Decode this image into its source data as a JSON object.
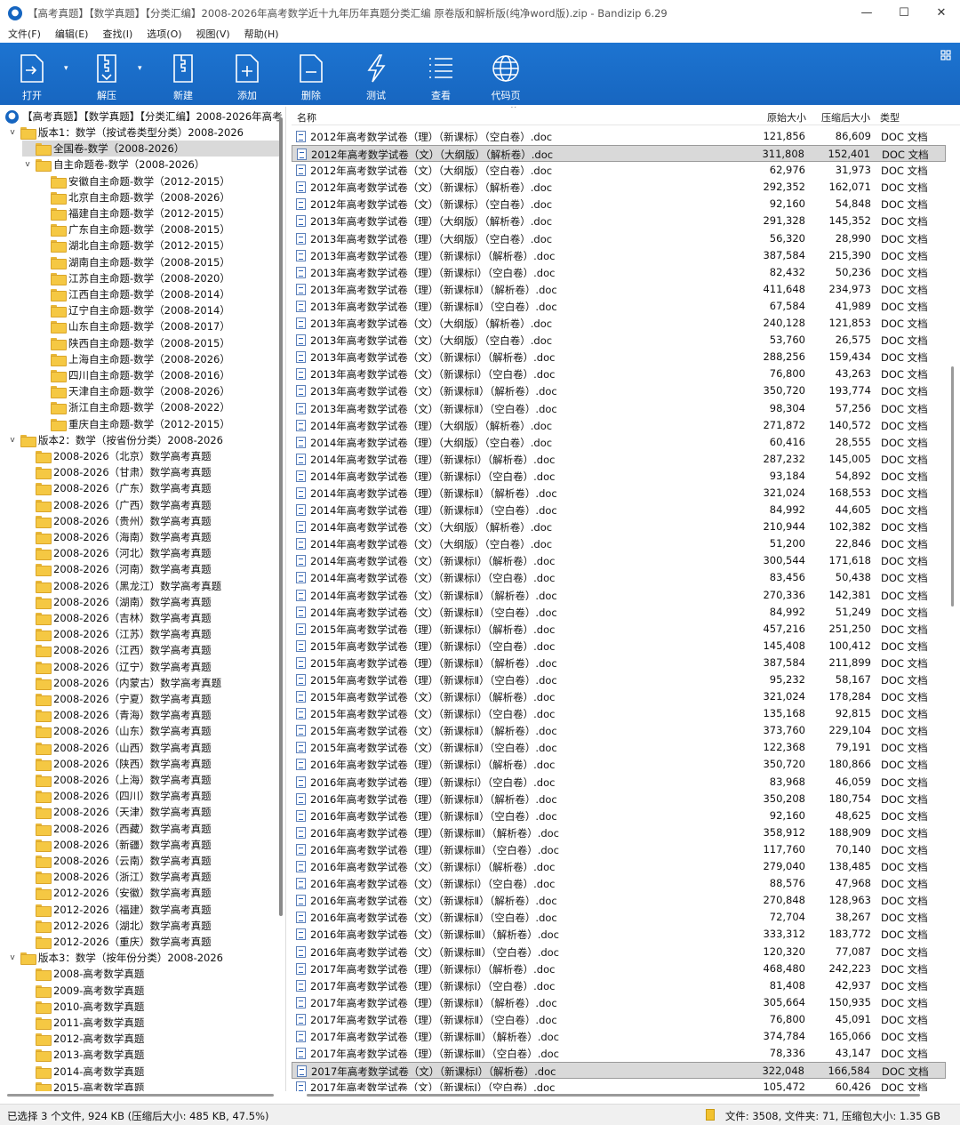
{
  "window": {
    "title": "【高考真题】【数学真题】【分类汇编】2008-2026年高考数学近十九年历年真题分类汇编  原卷版和解析版(纯净word版).zip - Bandizip 6.29",
    "controls": [
      "—",
      "☐",
      "✕"
    ]
  },
  "menu": [
    "文件(F)",
    "编辑(E)",
    "查找(I)",
    "选项(O)",
    "视图(V)",
    "帮助(H)"
  ],
  "toolbar": {
    "open": "打开",
    "extract": "解压",
    "new": "新建",
    "add": "添加",
    "delete": "删除",
    "test": "测试",
    "view": "查看",
    "codepage": "代码页"
  },
  "tree": {
    "root": "【高考真题】【数学真题】【分类汇编】2008-2026年高考",
    "nodes": [
      {
        "label": "版本1：数学（按试卷类型分类）2008-2026",
        "level": 1,
        "expand": "v"
      },
      {
        "label": "全国卷-数学（2008-2026）",
        "level": 2,
        "expand": "",
        "selected": true
      },
      {
        "label": "自主命题卷-数学（2008-2026）",
        "level": 2,
        "expand": "v"
      },
      {
        "label": "安徽自主命题-数学（2012-2015）",
        "level": 3,
        "expand": ""
      },
      {
        "label": "北京自主命题-数学（2008-2026）",
        "level": 3,
        "expand": ""
      },
      {
        "label": "福建自主命题-数学（2012-2015）",
        "level": 3,
        "expand": ""
      },
      {
        "label": "广东自主命题-数学（2008-2015）",
        "level": 3,
        "expand": ""
      },
      {
        "label": "湖北自主命题-数学（2012-2015）",
        "level": 3,
        "expand": ""
      },
      {
        "label": "湖南自主命题-数学（2008-2015）",
        "level": 3,
        "expand": ""
      },
      {
        "label": "江苏自主命题-数学（2008-2020）",
        "level": 3,
        "expand": ""
      },
      {
        "label": "江西自主命题-数学（2008-2014）",
        "level": 3,
        "expand": ""
      },
      {
        "label": "辽宁自主命题-数学（2008-2014）",
        "level": 3,
        "expand": ""
      },
      {
        "label": "山东自主命题-数学（2008-2017）",
        "level": 3,
        "expand": ""
      },
      {
        "label": "陕西自主命题-数学（2008-2015）",
        "level": 3,
        "expand": ""
      },
      {
        "label": "上海自主命题-数学（2008-2026）",
        "level": 3,
        "expand": ""
      },
      {
        "label": "四川自主命题-数学（2008-2016）",
        "level": 3,
        "expand": ""
      },
      {
        "label": "天津自主命题-数学（2008-2026）",
        "level": 3,
        "expand": ""
      },
      {
        "label": "浙江自主命题-数学（2008-2022）",
        "level": 3,
        "expand": ""
      },
      {
        "label": "重庆自主命题-数学（2012-2015）",
        "level": 3,
        "expand": ""
      },
      {
        "label": "版本2：数学（按省份分类）2008-2026",
        "level": 1,
        "expand": "v"
      },
      {
        "label": "2008-2026（北京）数学高考真题",
        "level": 2,
        "expand": ""
      },
      {
        "label": "2008-2026（甘肃）数学高考真题",
        "level": 2,
        "expand": ""
      },
      {
        "label": "2008-2026（广东）数学高考真题",
        "level": 2,
        "expand": ""
      },
      {
        "label": "2008-2026（广西）数学高考真题",
        "level": 2,
        "expand": ""
      },
      {
        "label": "2008-2026（贵州）数学高考真题",
        "level": 2,
        "expand": ""
      },
      {
        "label": "2008-2026（海南）数学高考真题",
        "level": 2,
        "expand": ""
      },
      {
        "label": "2008-2026（河北）数学高考真题",
        "level": 2,
        "expand": ""
      },
      {
        "label": "2008-2026（河南）数学高考真题",
        "level": 2,
        "expand": ""
      },
      {
        "label": "2008-2026（黑龙江）数学高考真题",
        "level": 2,
        "expand": ""
      },
      {
        "label": "2008-2026（湖南）数学高考真题",
        "level": 2,
        "expand": ""
      },
      {
        "label": "2008-2026（吉林）数学高考真题",
        "level": 2,
        "expand": ""
      },
      {
        "label": "2008-2026（江苏）数学高考真题",
        "level": 2,
        "expand": ""
      },
      {
        "label": "2008-2026（江西）数学高考真题",
        "level": 2,
        "expand": ""
      },
      {
        "label": "2008-2026（辽宁）数学高考真题",
        "level": 2,
        "expand": ""
      },
      {
        "label": "2008-2026（内蒙古）数学高考真题",
        "level": 2,
        "expand": ""
      },
      {
        "label": "2008-2026（宁夏）数学高考真题",
        "level": 2,
        "expand": ""
      },
      {
        "label": "2008-2026（青海）数学高考真题",
        "level": 2,
        "expand": ""
      },
      {
        "label": "2008-2026（山东）数学高考真题",
        "level": 2,
        "expand": ""
      },
      {
        "label": "2008-2026（山西）数学高考真题",
        "level": 2,
        "expand": ""
      },
      {
        "label": "2008-2026（陕西）数学高考真题",
        "level": 2,
        "expand": ""
      },
      {
        "label": "2008-2026（上海）数学高考真题",
        "level": 2,
        "expand": ""
      },
      {
        "label": "2008-2026（四川）数学高考真题",
        "level": 2,
        "expand": ""
      },
      {
        "label": "2008-2026（天津）数学高考真题",
        "level": 2,
        "expand": ""
      },
      {
        "label": "2008-2026（西藏）数学高考真题",
        "level": 2,
        "expand": ""
      },
      {
        "label": "2008-2026（新疆）数学高考真题",
        "level": 2,
        "expand": ""
      },
      {
        "label": "2008-2026（云南）数学高考真题",
        "level": 2,
        "expand": ""
      },
      {
        "label": "2008-2026（浙江）数学高考真题",
        "level": 2,
        "expand": ""
      },
      {
        "label": "2012-2026（安徽）数学高考真题",
        "level": 2,
        "expand": ""
      },
      {
        "label": "2012-2026（福建）数学高考真题",
        "level": 2,
        "expand": ""
      },
      {
        "label": "2012-2026（湖北）数学高考真题",
        "level": 2,
        "expand": ""
      },
      {
        "label": "2012-2026（重庆）数学高考真题",
        "level": 2,
        "expand": ""
      },
      {
        "label": "版本3：数学（按年份分类）2008-2026",
        "level": 1,
        "expand": "v"
      },
      {
        "label": "2008-高考数学真题",
        "level": 2,
        "expand": ""
      },
      {
        "label": "2009-高考数学真题",
        "level": 2,
        "expand": ""
      },
      {
        "label": "2010-高考数学真题",
        "level": 2,
        "expand": ""
      },
      {
        "label": "2011-高考数学真题",
        "level": 2,
        "expand": ""
      },
      {
        "label": "2012-高考数学真题",
        "level": 2,
        "expand": ""
      },
      {
        "label": "2013-高考数学真题",
        "level": 2,
        "expand": ""
      },
      {
        "label": "2014-高考数学真题",
        "level": 2,
        "expand": ""
      },
      {
        "label": "2015-高考数学真题",
        "level": 2,
        "expand": ""
      }
    ]
  },
  "columns": {
    "name": "名称",
    "orig": "原始大小",
    "comp": "压缩后大小",
    "type": "类型"
  },
  "files": [
    [
      "2012年高考数学试卷（理）（新课标）（空白卷）.doc",
      "121,856",
      "86,609",
      "DOC 文档",
      0
    ],
    [
      "2012年高考数学试卷（文）（大纲版）（解析卷）.doc",
      "311,808",
      "152,401",
      "DOC 文档",
      1
    ],
    [
      "2012年高考数学试卷（文）（大纲版）（空白卷）.doc",
      "62,976",
      "31,973",
      "DOC 文档",
      0
    ],
    [
      "2012年高考数学试卷（文）（新课标）（解析卷）.doc",
      "292,352",
      "162,071",
      "DOC 文档",
      0
    ],
    [
      "2012年高考数学试卷（文）（新课标）（空白卷）.doc",
      "92,160",
      "54,848",
      "DOC 文档",
      0
    ],
    [
      "2013年高考数学试卷（理）（大纲版）（解析卷）.doc",
      "291,328",
      "145,352",
      "DOC 文档",
      0
    ],
    [
      "2013年高考数学试卷（理）（大纲版）（空白卷）.doc",
      "56,320",
      "28,990",
      "DOC 文档",
      0
    ],
    [
      "2013年高考数学试卷（理）（新课标Ⅰ）（解析卷）.doc",
      "387,584",
      "215,390",
      "DOC 文档",
      0
    ],
    [
      "2013年高考数学试卷（理）（新课标Ⅰ）（空白卷）.doc",
      "82,432",
      "50,236",
      "DOC 文档",
      0
    ],
    [
      "2013年高考数学试卷（理）（新课标Ⅱ）（解析卷）.doc",
      "411,648",
      "234,973",
      "DOC 文档",
      0
    ],
    [
      "2013年高考数学试卷（理）（新课标Ⅱ）（空白卷）.doc",
      "67,584",
      "41,989",
      "DOC 文档",
      0
    ],
    [
      "2013年高考数学试卷（文）（大纲版）（解析卷）.doc",
      "240,128",
      "121,853",
      "DOC 文档",
      0
    ],
    [
      "2013年高考数学试卷（文）（大纲版）（空白卷）.doc",
      "53,760",
      "26,575",
      "DOC 文档",
      0
    ],
    [
      "2013年高考数学试卷（文）（新课标Ⅰ）（解析卷）.doc",
      "288,256",
      "159,434",
      "DOC 文档",
      0
    ],
    [
      "2013年高考数学试卷（文）（新课标Ⅰ）（空白卷）.doc",
      "76,800",
      "43,263",
      "DOC 文档",
      0
    ],
    [
      "2013年高考数学试卷（文）（新课标Ⅱ）（解析卷）.doc",
      "350,720",
      "193,774",
      "DOC 文档",
      0
    ],
    [
      "2013年高考数学试卷（文）（新课标Ⅱ）（空白卷）.doc",
      "98,304",
      "57,256",
      "DOC 文档",
      0
    ],
    [
      "2014年高考数学试卷（理）（大纲版）（解析卷）.doc",
      "271,872",
      "140,572",
      "DOC 文档",
      0
    ],
    [
      "2014年高考数学试卷（理）（大纲版）（空白卷）.doc",
      "60,416",
      "28,555",
      "DOC 文档",
      0
    ],
    [
      "2014年高考数学试卷（理）（新课标Ⅰ）（解析卷）.doc",
      "287,232",
      "145,005",
      "DOC 文档",
      0
    ],
    [
      "2014年高考数学试卷（理）（新课标Ⅰ）（空白卷）.doc",
      "93,184",
      "54,892",
      "DOC 文档",
      0
    ],
    [
      "2014年高考数学试卷（理）（新课标Ⅱ）（解析卷）.doc",
      "321,024",
      "168,553",
      "DOC 文档",
      0
    ],
    [
      "2014年高考数学试卷（理）（新课标Ⅱ）（空白卷）.doc",
      "84,992",
      "44,605",
      "DOC 文档",
      0
    ],
    [
      "2014年高考数学试卷（文）（大纲版）（解析卷）.doc",
      "210,944",
      "102,382",
      "DOC 文档",
      0
    ],
    [
      "2014年高考数学试卷（文）（大纲版）（空白卷）.doc",
      "51,200",
      "22,846",
      "DOC 文档",
      0
    ],
    [
      "2014年高考数学试卷（文）（新课标Ⅰ）（解析卷）.doc",
      "300,544",
      "171,618",
      "DOC 文档",
      0
    ],
    [
      "2014年高考数学试卷（文）（新课标Ⅰ）（空白卷）.doc",
      "83,456",
      "50,438",
      "DOC 文档",
      0
    ],
    [
      "2014年高考数学试卷（文）（新课标Ⅱ）（解析卷）.doc",
      "270,336",
      "142,381",
      "DOC 文档",
      0
    ],
    [
      "2014年高考数学试卷（文）（新课标Ⅱ）（空白卷）.doc",
      "84,992",
      "51,249",
      "DOC 文档",
      0
    ],
    [
      "2015年高考数学试卷（理）（新课标Ⅰ）（解析卷）.doc",
      "457,216",
      "251,250",
      "DOC 文档",
      0
    ],
    [
      "2015年高考数学试卷（理）（新课标Ⅰ）（空白卷）.doc",
      "145,408",
      "100,412",
      "DOC 文档",
      0
    ],
    [
      "2015年高考数学试卷（理）（新课标Ⅱ）（解析卷）.doc",
      "387,584",
      "211,899",
      "DOC 文档",
      0
    ],
    [
      "2015年高考数学试卷（理）（新课标Ⅱ）（空白卷）.doc",
      "95,232",
      "58,167",
      "DOC 文档",
      0
    ],
    [
      "2015年高考数学试卷（文）（新课标Ⅰ）（解析卷）.doc",
      "321,024",
      "178,284",
      "DOC 文档",
      0
    ],
    [
      "2015年高考数学试卷（文）（新课标Ⅰ）（空白卷）.doc",
      "135,168",
      "92,815",
      "DOC 文档",
      0
    ],
    [
      "2015年高考数学试卷（文）（新课标Ⅱ）（解析卷）.doc",
      "373,760",
      "229,104",
      "DOC 文档",
      0
    ],
    [
      "2015年高考数学试卷（文）（新课标Ⅱ）（空白卷）.doc",
      "122,368",
      "79,191",
      "DOC 文档",
      0
    ],
    [
      "2016年高考数学试卷（理）（新课标Ⅰ）（解析卷）.doc",
      "350,720",
      "180,866",
      "DOC 文档",
      0
    ],
    [
      "2016年高考数学试卷（理）（新课标Ⅰ）（空白卷）.doc",
      "83,968",
      "46,059",
      "DOC 文档",
      0
    ],
    [
      "2016年高考数学试卷（理）（新课标Ⅱ）（解析卷）.doc",
      "350,208",
      "180,754",
      "DOC 文档",
      0
    ],
    [
      "2016年高考数学试卷（理）（新课标Ⅱ）（空白卷）.doc",
      "92,160",
      "48,625",
      "DOC 文档",
      0
    ],
    [
      "2016年高考数学试卷（理）（新课标Ⅲ）（解析卷）.doc",
      "358,912",
      "188,909",
      "DOC 文档",
      0
    ],
    [
      "2016年高考数学试卷（理）（新课标Ⅲ）（空白卷）.doc",
      "117,760",
      "70,140",
      "DOC 文档",
      0
    ],
    [
      "2016年高考数学试卷（文）（新课标Ⅰ）（解析卷）.doc",
      "279,040",
      "138,485",
      "DOC 文档",
      0
    ],
    [
      "2016年高考数学试卷（文）（新课标Ⅰ）（空白卷）.doc",
      "88,576",
      "47,968",
      "DOC 文档",
      0
    ],
    [
      "2016年高考数学试卷（文）（新课标Ⅱ）（解析卷）.doc",
      "270,848",
      "128,963",
      "DOC 文档",
      0
    ],
    [
      "2016年高考数学试卷（文）（新课标Ⅱ）（空白卷）.doc",
      "72,704",
      "38,267",
      "DOC 文档",
      0
    ],
    [
      "2016年高考数学试卷（文）（新课标Ⅲ）（解析卷）.doc",
      "333,312",
      "183,772",
      "DOC 文档",
      0
    ],
    [
      "2016年高考数学试卷（文）（新课标Ⅲ）（空白卷）.doc",
      "120,320",
      "77,087",
      "DOC 文档",
      0
    ],
    [
      "2017年高考数学试卷（理）（新课标Ⅰ）（解析卷）.doc",
      "468,480",
      "242,223",
      "DOC 文档",
      0
    ],
    [
      "2017年高考数学试卷（理）（新课标Ⅰ）（空白卷）.doc",
      "81,408",
      "42,937",
      "DOC 文档",
      0
    ],
    [
      "2017年高考数学试卷（理）（新课标Ⅱ）（解析卷）.doc",
      "305,664",
      "150,935",
      "DOC 文档",
      0
    ],
    [
      "2017年高考数学试卷（理）（新课标Ⅱ）（空白卷）.doc",
      "76,800",
      "45,091",
      "DOC 文档",
      0
    ],
    [
      "2017年高考数学试卷（理）（新课标Ⅲ）（解析卷）.doc",
      "374,784",
      "165,066",
      "DOC 文档",
      0
    ],
    [
      "2017年高考数学试卷（理）（新课标Ⅲ）（空白卷）.doc",
      "78,336",
      "43,147",
      "DOC 文档",
      0
    ],
    [
      "2017年高考数学试卷（文）（新课标Ⅰ）（解析卷）.doc",
      "322,048",
      "166,584",
      "DOC 文档",
      1
    ],
    [
      "2017年高考数学试卷（文）（新课标Ⅰ）（空白卷）.doc",
      "105,472",
      "60,426",
      "DOC 文档",
      0
    ]
  ],
  "status": {
    "left": "已选择 3 个文件, 924 KB (压缩后大小: 485 KB, 47.5%)",
    "right": "文件: 3508, 文件夹: 71, 压缩包大小: 1.35 GB"
  }
}
